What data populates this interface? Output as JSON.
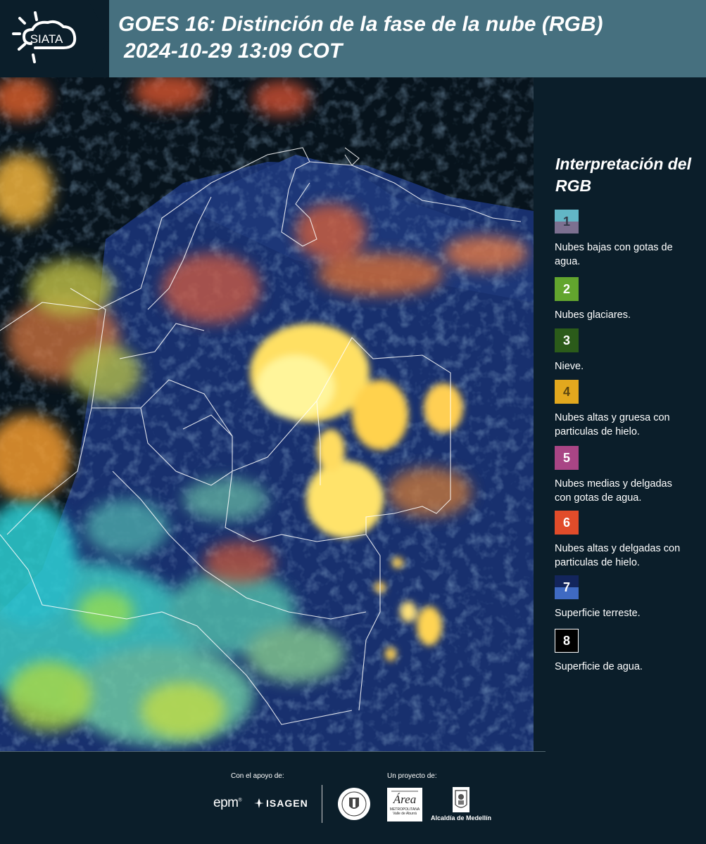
{
  "header": {
    "logo_text": "SIATA",
    "title_line1": "GOES 16: Distinción de la fase de la nube (RGB)",
    "title_line2": "2024-10-29 13:09 COT"
  },
  "map": {
    "content": "satellite-rgb-cloud-phase-image"
  },
  "legend": {
    "title": "Interpretación del RGB",
    "items": [
      {
        "number": "1",
        "label": "Nubes bajas con gotas de agua.",
        "color_top": "#62b6c6",
        "color_bottom": "#7c7090"
      },
      {
        "number": "2",
        "label": "Nubes glaciares.",
        "color_top": "#62a52e",
        "color_bottom": "#62a52e"
      },
      {
        "number": "3",
        "label": "Nieve.",
        "color_top": "#2b5b1a",
        "color_bottom": "#2b5b1a"
      },
      {
        "number": "4",
        "label": "Nubes altas y gruesa con particulas de hielo.",
        "color_top": "#e2a81e",
        "color_bottom": "#e2a81e"
      },
      {
        "number": "5",
        "label": "Nubes medias y delgadas con gotas de agua.",
        "color_top": "#a94585",
        "color_bottom": "#a94585"
      },
      {
        "number": "6",
        "label": "Nubes altas y delgadas con particulas de hielo.",
        "color_top": "#e14c2a",
        "color_bottom": "#e14c2a"
      },
      {
        "number": "7",
        "label": "Superficie terreste.",
        "color_top": "#13255c",
        "color_bottom": "#3f6ac2"
      },
      {
        "number": "8",
        "label": "Superficie de agua.",
        "color_top": "#000000",
        "color_bottom": "#000000"
      }
    ]
  },
  "footer": {
    "support_label": "Con el apoyo de:",
    "project_label": "Un proyecto de:",
    "epm": "epm",
    "isagen": "ISAGEN",
    "area_text": "METROPOLITANA Valle de Aburrá",
    "area_script": "Área",
    "alcaldia": "Alcaldía de Medellín"
  }
}
